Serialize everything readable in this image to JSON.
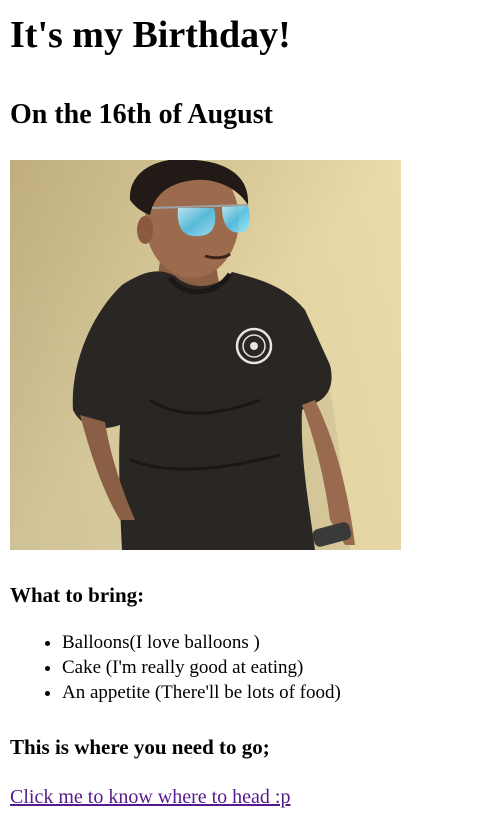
{
  "page": {
    "title": "It's my Birthday!",
    "subtitle": "On the 16th of August",
    "bring_heading": "What to bring:",
    "bring_items": [
      "Balloons(I love balloons )",
      "Cake (I'm really good at eating)",
      "An appetite (There'll be lots of food)"
    ],
    "where_heading": "This is where you need to go;",
    "location_link": "Click me to know where to head :p"
  },
  "colors": {
    "link_visited": "#551a8b",
    "text": "#000000",
    "background": "#ffffff"
  }
}
